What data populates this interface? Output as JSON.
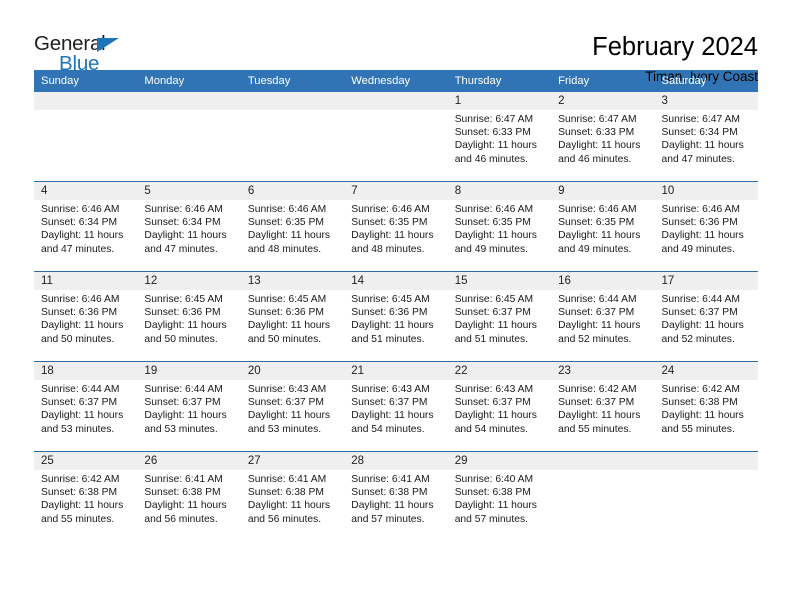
{
  "logo": {
    "primary_text": "General",
    "secondary_text": "Blue",
    "triangle_icon": "triangle-icon",
    "primary_color": "#231f20",
    "secondary_color": "#1b75bb"
  },
  "header": {
    "month_title": "February 2024",
    "location": "Timan, Ivory Coast"
  },
  "theme": {
    "header_background": "#3174b5",
    "header_text": "#ffffff",
    "row_separator": "#2e6da4",
    "daynum_background": "#efefef",
    "cell_background": "#ffffff"
  },
  "calendar": {
    "weekday_headers": [
      "Sunday",
      "Monday",
      "Tuesday",
      "Wednesday",
      "Thursday",
      "Friday",
      "Saturday"
    ],
    "labels": {
      "sunrise_prefix": "Sunrise:",
      "sunset_prefix": "Sunset:",
      "daylight_prefix": "Daylight:"
    },
    "weeks": [
      [
        {
          "day": "",
          "empty": true
        },
        {
          "day": "",
          "empty": true
        },
        {
          "day": "",
          "empty": true
        },
        {
          "day": "",
          "empty": true
        },
        {
          "day": "1",
          "sunrise": "Sunrise: 6:47 AM",
          "sunset": "Sunset: 6:33 PM",
          "daylight_line1": "Daylight: 11 hours",
          "daylight_line2": "and 46 minutes."
        },
        {
          "day": "2",
          "sunrise": "Sunrise: 6:47 AM",
          "sunset": "Sunset: 6:33 PM",
          "daylight_line1": "Daylight: 11 hours",
          "daylight_line2": "and 46 minutes."
        },
        {
          "day": "3",
          "sunrise": "Sunrise: 6:47 AM",
          "sunset": "Sunset: 6:34 PM",
          "daylight_line1": "Daylight: 11 hours",
          "daylight_line2": "and 47 minutes."
        }
      ],
      [
        {
          "day": "4",
          "sunrise": "Sunrise: 6:46 AM",
          "sunset": "Sunset: 6:34 PM",
          "daylight_line1": "Daylight: 11 hours",
          "daylight_line2": "and 47 minutes."
        },
        {
          "day": "5",
          "sunrise": "Sunrise: 6:46 AM",
          "sunset": "Sunset: 6:34 PM",
          "daylight_line1": "Daylight: 11 hours",
          "daylight_line2": "and 47 minutes."
        },
        {
          "day": "6",
          "sunrise": "Sunrise: 6:46 AM",
          "sunset": "Sunset: 6:35 PM",
          "daylight_line1": "Daylight: 11 hours",
          "daylight_line2": "and 48 minutes."
        },
        {
          "day": "7",
          "sunrise": "Sunrise: 6:46 AM",
          "sunset": "Sunset: 6:35 PM",
          "daylight_line1": "Daylight: 11 hours",
          "daylight_line2": "and 48 minutes."
        },
        {
          "day": "8",
          "sunrise": "Sunrise: 6:46 AM",
          "sunset": "Sunset: 6:35 PM",
          "daylight_line1": "Daylight: 11 hours",
          "daylight_line2": "and 49 minutes."
        },
        {
          "day": "9",
          "sunrise": "Sunrise: 6:46 AM",
          "sunset": "Sunset: 6:35 PM",
          "daylight_line1": "Daylight: 11 hours",
          "daylight_line2": "and 49 minutes."
        },
        {
          "day": "10",
          "sunrise": "Sunrise: 6:46 AM",
          "sunset": "Sunset: 6:36 PM",
          "daylight_line1": "Daylight: 11 hours",
          "daylight_line2": "and 49 minutes."
        }
      ],
      [
        {
          "day": "11",
          "sunrise": "Sunrise: 6:46 AM",
          "sunset": "Sunset: 6:36 PM",
          "daylight_line1": "Daylight: 11 hours",
          "daylight_line2": "and 50 minutes."
        },
        {
          "day": "12",
          "sunrise": "Sunrise: 6:45 AM",
          "sunset": "Sunset: 6:36 PM",
          "daylight_line1": "Daylight: 11 hours",
          "daylight_line2": "and 50 minutes."
        },
        {
          "day": "13",
          "sunrise": "Sunrise: 6:45 AM",
          "sunset": "Sunset: 6:36 PM",
          "daylight_line1": "Daylight: 11 hours",
          "daylight_line2": "and 50 minutes."
        },
        {
          "day": "14",
          "sunrise": "Sunrise: 6:45 AM",
          "sunset": "Sunset: 6:36 PM",
          "daylight_line1": "Daylight: 11 hours",
          "daylight_line2": "and 51 minutes."
        },
        {
          "day": "15",
          "sunrise": "Sunrise: 6:45 AM",
          "sunset": "Sunset: 6:37 PM",
          "daylight_line1": "Daylight: 11 hours",
          "daylight_line2": "and 51 minutes."
        },
        {
          "day": "16",
          "sunrise": "Sunrise: 6:44 AM",
          "sunset": "Sunset: 6:37 PM",
          "daylight_line1": "Daylight: 11 hours",
          "daylight_line2": "and 52 minutes."
        },
        {
          "day": "17",
          "sunrise": "Sunrise: 6:44 AM",
          "sunset": "Sunset: 6:37 PM",
          "daylight_line1": "Daylight: 11 hours",
          "daylight_line2": "and 52 minutes."
        }
      ],
      [
        {
          "day": "18",
          "sunrise": "Sunrise: 6:44 AM",
          "sunset": "Sunset: 6:37 PM",
          "daylight_line1": "Daylight: 11 hours",
          "daylight_line2": "and 53 minutes."
        },
        {
          "day": "19",
          "sunrise": "Sunrise: 6:44 AM",
          "sunset": "Sunset: 6:37 PM",
          "daylight_line1": "Daylight: 11 hours",
          "daylight_line2": "and 53 minutes."
        },
        {
          "day": "20",
          "sunrise": "Sunrise: 6:43 AM",
          "sunset": "Sunset: 6:37 PM",
          "daylight_line1": "Daylight: 11 hours",
          "daylight_line2": "and 53 minutes."
        },
        {
          "day": "21",
          "sunrise": "Sunrise: 6:43 AM",
          "sunset": "Sunset: 6:37 PM",
          "daylight_line1": "Daylight: 11 hours",
          "daylight_line2": "and 54 minutes."
        },
        {
          "day": "22",
          "sunrise": "Sunrise: 6:43 AM",
          "sunset": "Sunset: 6:37 PM",
          "daylight_line1": "Daylight: 11 hours",
          "daylight_line2": "and 54 minutes."
        },
        {
          "day": "23",
          "sunrise": "Sunrise: 6:42 AM",
          "sunset": "Sunset: 6:37 PM",
          "daylight_line1": "Daylight: 11 hours",
          "daylight_line2": "and 55 minutes."
        },
        {
          "day": "24",
          "sunrise": "Sunrise: 6:42 AM",
          "sunset": "Sunset: 6:38 PM",
          "daylight_line1": "Daylight: 11 hours",
          "daylight_line2": "and 55 minutes."
        }
      ],
      [
        {
          "day": "25",
          "sunrise": "Sunrise: 6:42 AM",
          "sunset": "Sunset: 6:38 PM",
          "daylight_line1": "Daylight: 11 hours",
          "daylight_line2": "and 55 minutes."
        },
        {
          "day": "26",
          "sunrise": "Sunrise: 6:41 AM",
          "sunset": "Sunset: 6:38 PM",
          "daylight_line1": "Daylight: 11 hours",
          "daylight_line2": "and 56 minutes."
        },
        {
          "day": "27",
          "sunrise": "Sunrise: 6:41 AM",
          "sunset": "Sunset: 6:38 PM",
          "daylight_line1": "Daylight: 11 hours",
          "daylight_line2": "and 56 minutes."
        },
        {
          "day": "28",
          "sunrise": "Sunrise: 6:41 AM",
          "sunset": "Sunset: 6:38 PM",
          "daylight_line1": "Daylight: 11 hours",
          "daylight_line2": "and 57 minutes."
        },
        {
          "day": "29",
          "sunrise": "Sunrise: 6:40 AM",
          "sunset": "Sunset: 6:38 PM",
          "daylight_line1": "Daylight: 11 hours",
          "daylight_line2": "and 57 minutes."
        },
        {
          "day": "",
          "empty": true
        },
        {
          "day": "",
          "empty": true
        }
      ]
    ]
  }
}
